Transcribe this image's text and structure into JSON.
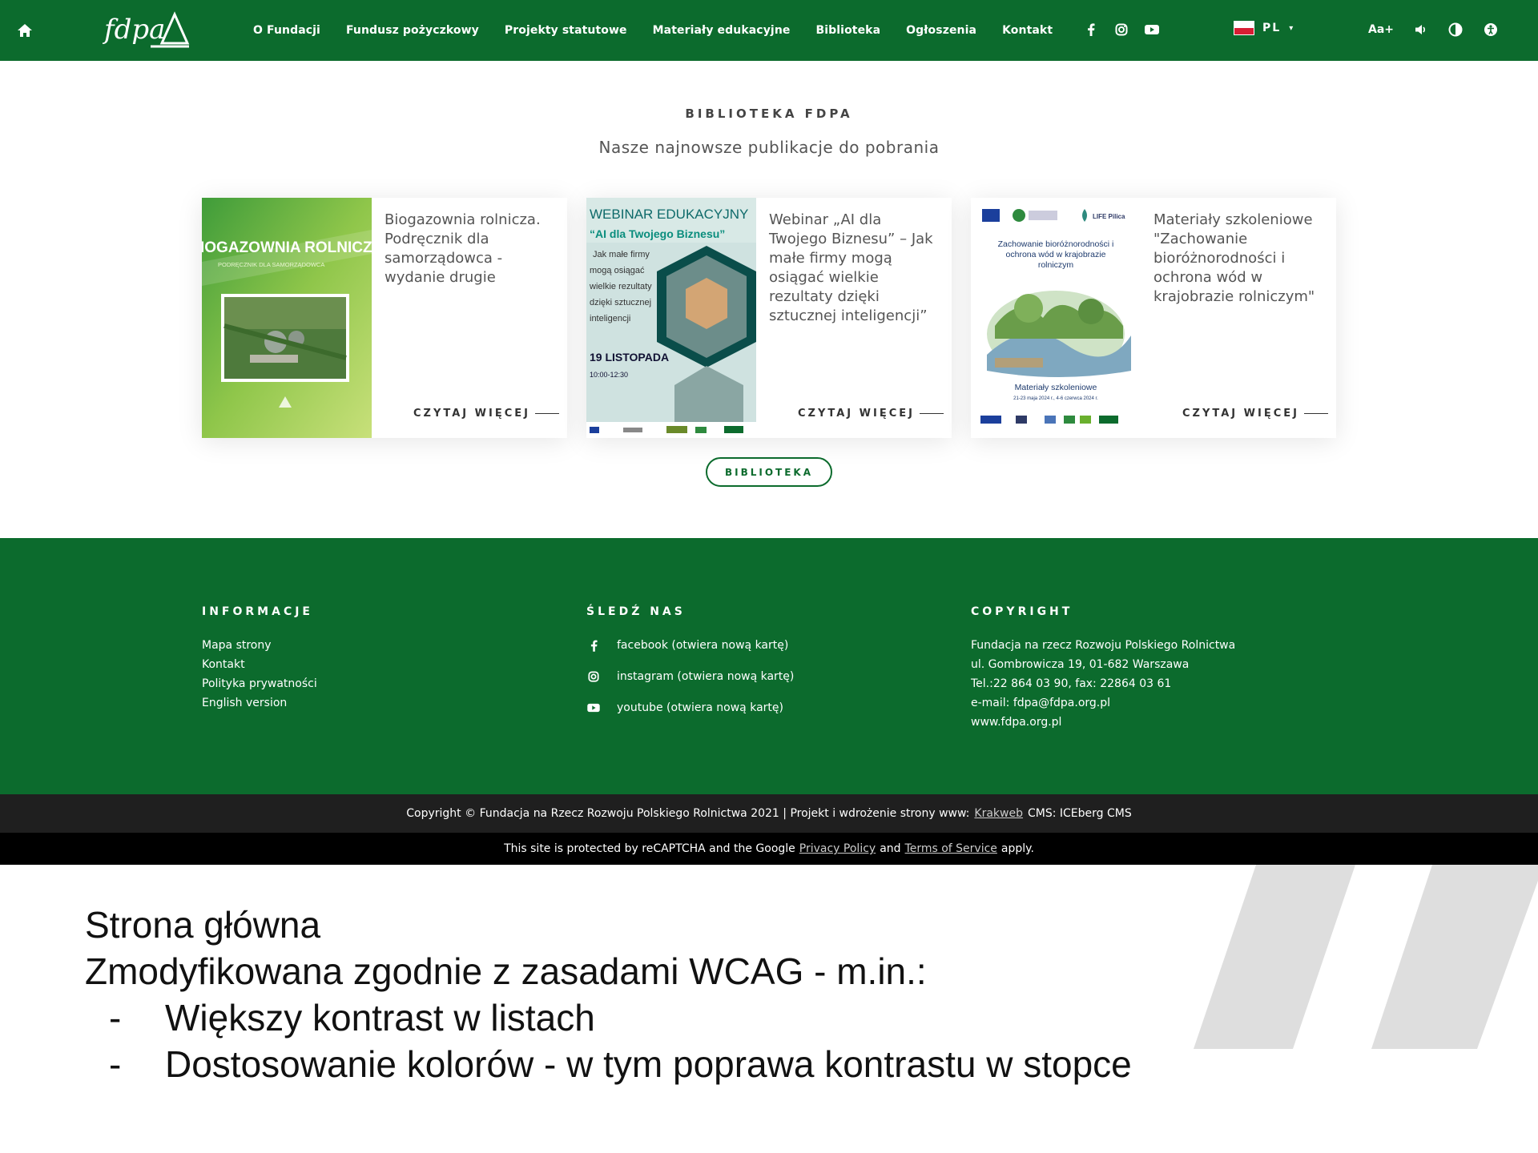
{
  "header": {
    "nav": [
      "O Fundacji",
      "Fundusz pożyczkowy",
      "Projekty statutowe",
      "Materiały edukacyjne",
      "Biblioteka",
      "Ogłoszenia",
      "Kontakt"
    ],
    "lang": "PL",
    "font_size_label": "Aa+",
    "logo_text": "fdpa"
  },
  "library": {
    "kicker": "BIBLIOTEKA FDPA",
    "title": "Nasze najnowsze publikacje do pobrania",
    "button": "BIBLIOTEKA",
    "read_more": "CZYTAJ WIĘCEJ",
    "cards": [
      {
        "title": "Biogazownia rolnicza. Podręcznik dla samorządowca - wydanie drugie",
        "cover_text": "IOGAZOWNIA ROLNICZ",
        "cover_sub": "PODRĘCZNIK DLA SAMORZĄDOWCA"
      },
      {
        "title": "Webinar „AI dla Twojego Biznesu” – Jak małe firmy mogą osiągać wielkie rezultaty dzięki sztucznej inteligencji”",
        "cover_text": "WEBINAR EDUKACYJNY",
        "cover_sub": "“AI dla Twojego Biznesu”",
        "cover_lines": [
          "Jak małe firmy",
          "mogą osiągać",
          "wielkie rezultaty",
          "dzięki sztucznej",
          "inteligencji"
        ],
        "cover_date": "19 LISTOPADA",
        "cover_time": "10:00-12:30"
      },
      {
        "title": "Materiały szkoleniowe \"Zachowanie bioróżnorodności i ochrona wód w krajobrazie rolniczym\"",
        "cover_text": "Zachowanie bioróżnorodności i ochrona wód w krajobrazie rolniczym",
        "cover_sub": "Materiały szkoleniowe",
        "cover_dates": "21-23 maja 2024 r., 4-6 czerwca 2024 r.",
        "cover_logo": "LIFE Pilica"
      }
    ]
  },
  "footer": {
    "info": {
      "heading": "INFORMACJE",
      "links": [
        "Mapa strony",
        "Kontakt",
        "Polityka prywatności",
        "English version"
      ]
    },
    "follow": {
      "heading": "ŚLEDŹ NAS",
      "links": [
        "facebook (otwiera nową kartę)",
        "instagram (otwiera nową kartę)",
        "youtube (otwiera nową kartę)"
      ]
    },
    "copyright": {
      "heading": "COPYRIGHT",
      "lines": [
        "Fundacja na rzecz Rozwoju Polskiego Rolnictwa",
        "ul. Gombrowicza 19, 01-682 Warszawa",
        "Tel.:22 864 03 90, fax: 22864 03 61",
        "e-mail: fdpa@fdpa.org.pl",
        "www.fdpa.org.pl"
      ]
    }
  },
  "copybar": {
    "text": "Copyright © Fundacja na Rzecz Rozwoju Polskiego Rolnictwa 2021  |  Projekt i wdrożenie strony www:",
    "link": "Krakweb",
    "tail": "CMS: ICEberg CMS"
  },
  "recaptcha": {
    "pre": "This site is protected by reCAPTCHA and the Google",
    "privacy": "Privacy Policy",
    "and": "and",
    "terms": "Terms of Service",
    "post": "apply."
  },
  "notes": {
    "line1": "Strona główna",
    "line2": "Zmodyfikowana zgodnie z zasadami WCAG - m.in.:",
    "bullets": [
      "Większy kontrast w listach",
      "Dostosowanie kolorów - w tym poprawa kontrastu w stopce"
    ]
  },
  "colors": {
    "brand_green": "#0c6b2d",
    "copy_bar": "#1f1f1f",
    "recaptcha_bar": "#000000"
  },
  "icons": [
    "home-icon",
    "facebook-icon",
    "instagram-icon",
    "youtube-icon",
    "flag-pl-icon",
    "volume-icon",
    "contrast-icon",
    "accessibility-icon"
  ]
}
